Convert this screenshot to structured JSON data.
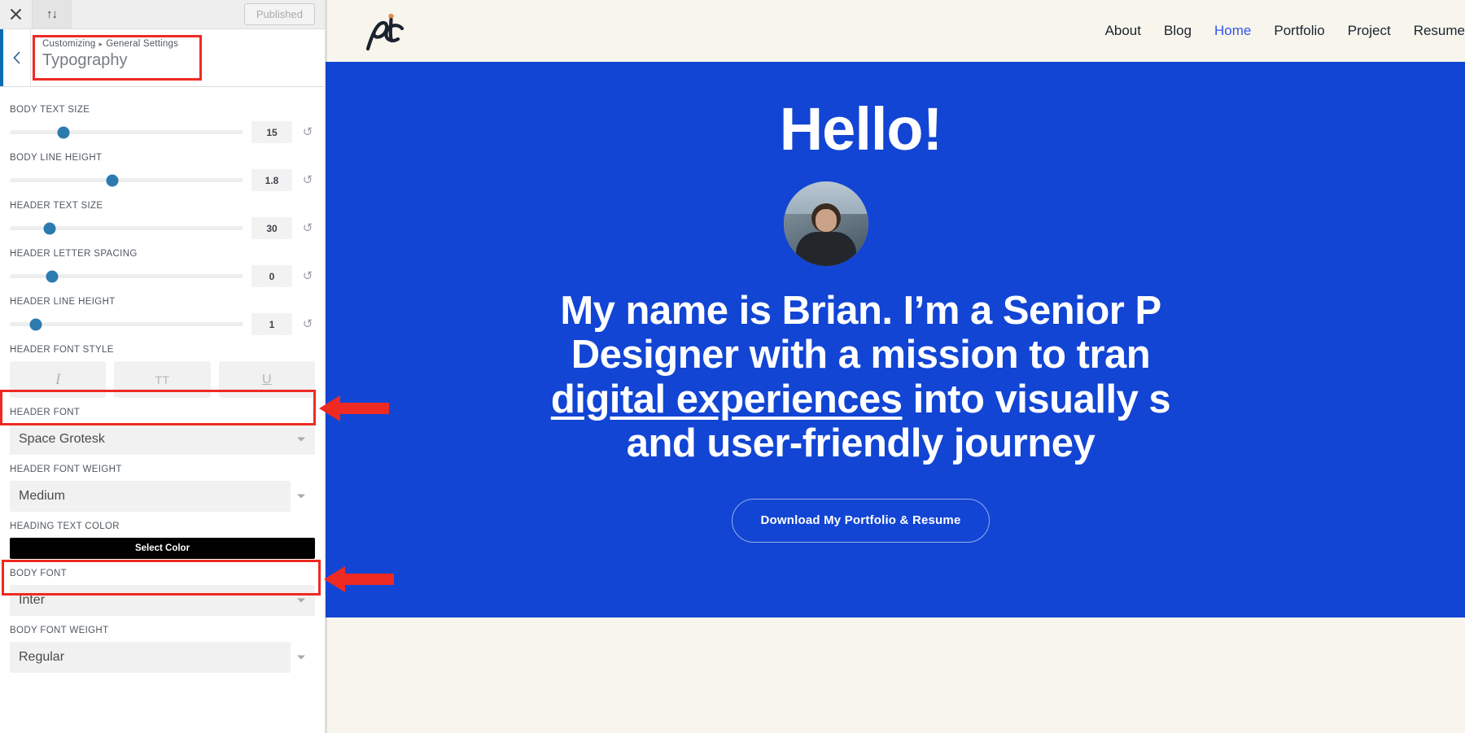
{
  "customizer": {
    "topbar": {
      "close_icon": "close-icon",
      "devices_icon": "device-toggle-icon",
      "publish_label": "Published"
    },
    "header": {
      "back_icon": "chevron-left-icon",
      "breadcrumb_root": "Customizing",
      "breadcrumb_separator": "▸",
      "breadcrumb_parent": "General Settings",
      "panel_title": "Typography"
    },
    "sliders": [
      {
        "label": "BODY TEXT SIZE",
        "value": "15",
        "percent": 23
      },
      {
        "label": "BODY LINE HEIGHT",
        "value": "1.8",
        "percent": 44
      },
      {
        "label": "HEADER TEXT SIZE",
        "value": "30",
        "percent": 17
      },
      {
        "label": "HEADER LETTER SPACING",
        "value": "0",
        "percent": 18
      },
      {
        "label": "HEADER LINE HEIGHT",
        "value": "1",
        "percent": 11
      }
    ],
    "font_style": {
      "label": "HEADER FONT STYLE",
      "buttons": [
        {
          "name": "italic-button",
          "glyph": "I"
        },
        {
          "name": "uppercase-button",
          "glyph": "TT"
        },
        {
          "name": "underline-button",
          "glyph": "U"
        }
      ]
    },
    "header_font": {
      "label": "HEADER FONT",
      "value": "Space Grotesk"
    },
    "header_font_weight": {
      "label": "HEADER FONT WEIGHT",
      "value": "Medium"
    },
    "heading_text_color": {
      "label": "HEADING TEXT COLOR",
      "button_label": "Select Color",
      "swatch": "#000000"
    },
    "body_font": {
      "label": "BODY FONT",
      "value": "Inter"
    },
    "body_font_weight": {
      "label": "BODY FONT WEIGHT",
      "value": "Regular"
    }
  },
  "annotations": {
    "highlight_color": "#ee2a23",
    "boxes": [
      "Typography panel title",
      "Header Font select",
      "Body Font select"
    ],
    "arrows": [
      "arrow pointing to Header Font select",
      "arrow pointing to Body Font select"
    ]
  },
  "preview": {
    "background": "#f7f5ec",
    "hero_background": "#1245d4",
    "accent": "#2f55ef",
    "logo_alt": "pc monogram logo",
    "nav": [
      {
        "label": "About",
        "active": false
      },
      {
        "label": "Blog",
        "active": false
      },
      {
        "label": "Home",
        "active": true
      },
      {
        "label": "Portfolio",
        "active": false
      },
      {
        "label": "Project",
        "active": false
      },
      {
        "label": "Resume",
        "active": false
      }
    ],
    "hero": {
      "greeting": "Hello!",
      "avatar_alt": "Portrait photo of Brian",
      "line1": "My name is Brian. I’m a Senior P",
      "line2": "Designer with a mission to tran",
      "line3_underlined": "digital experiences",
      "line3_rest": " into visually s",
      "line4": "and user-friendly journey",
      "cta_label": "Download My Portfolio & Resume"
    }
  }
}
